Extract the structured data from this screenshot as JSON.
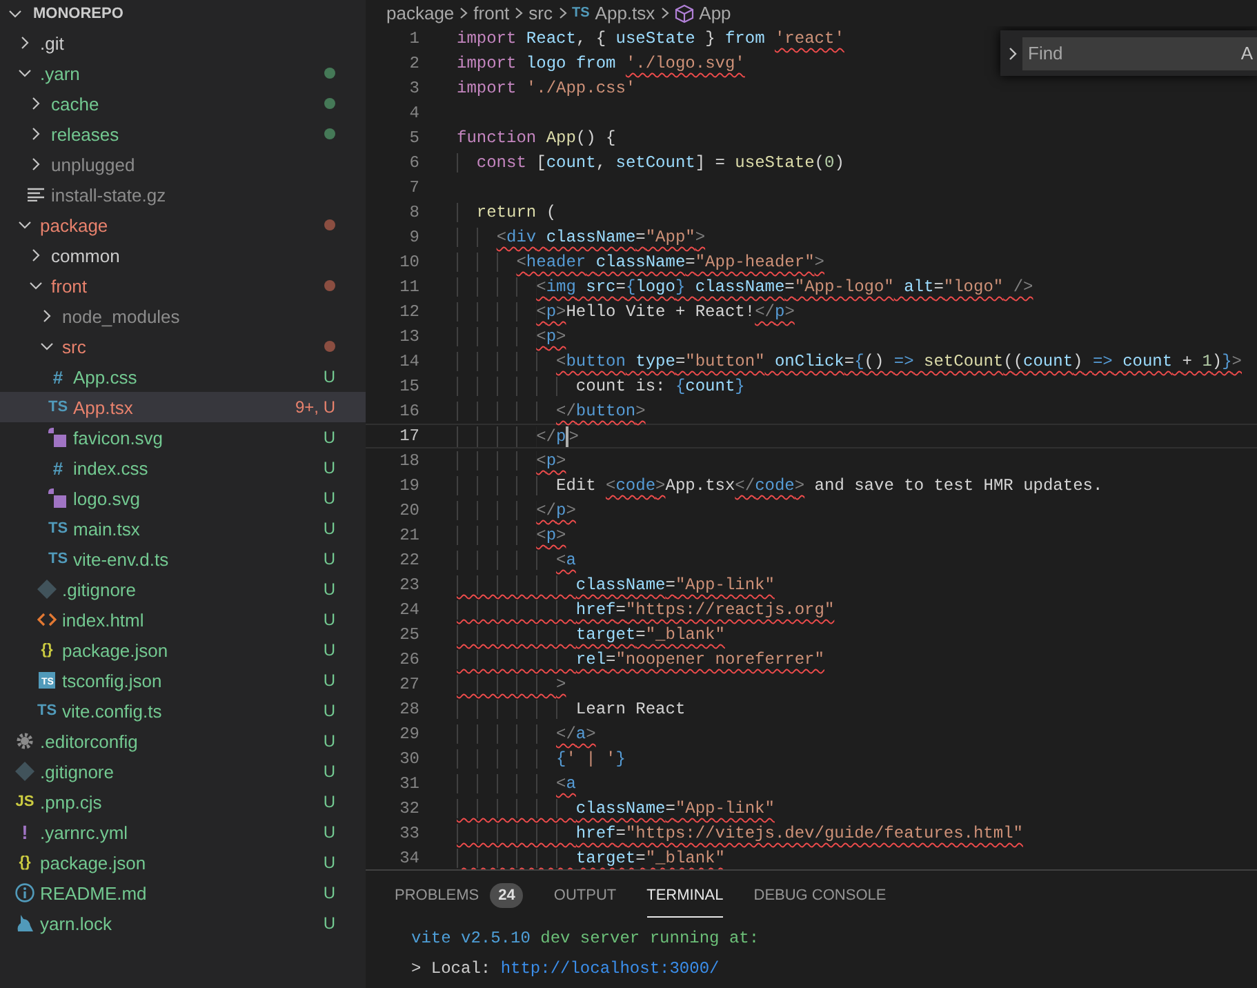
{
  "sidebar": {
    "title": "MONOREPO",
    "expanded": true,
    "items": [
      {
        "name": ".git",
        "kind": "folder",
        "expanded": false,
        "color": "#cccccc",
        "dot": false,
        "selected": false
      },
      {
        "name": ".yarn",
        "kind": "folder",
        "expanded": true,
        "color": "#73c991",
        "dot": true,
        "selected": false,
        "children": [
          {
            "name": "cache",
            "kind": "folder",
            "expanded": false,
            "color": "#73c991",
            "dot": true,
            "selected": false
          },
          {
            "name": "releases",
            "kind": "folder",
            "expanded": false,
            "color": "#73c991",
            "dot": true,
            "selected": false
          },
          {
            "name": "unplugged",
            "kind": "folder",
            "expanded": false,
            "color": "#8c8c8c",
            "dot": false,
            "selected": false
          },
          {
            "name": "install-state.gz",
            "kind": "lines",
            "color": "#8c8c8c",
            "selected": false
          }
        ]
      },
      {
        "name": "package",
        "kind": "folder",
        "expanded": true,
        "color": "#e8826d",
        "dot": true,
        "selected": false,
        "children": [
          {
            "name": "common",
            "kind": "folder",
            "expanded": false,
            "color": "#cccccc",
            "dot": false,
            "selected": false
          },
          {
            "name": "front",
            "kind": "folder",
            "expanded": true,
            "color": "#e8826d",
            "dot": true,
            "selected": false,
            "children": [
              {
                "name": "node_modules",
                "kind": "folder",
                "expanded": false,
                "color": "#8c8c8c",
                "dot": false,
                "selected": false
              },
              {
                "name": "src",
                "kind": "folder",
                "expanded": true,
                "color": "#e8826d",
                "dot": true,
                "selected": false,
                "children": [
                  {
                    "name": "App.css",
                    "kind": "css",
                    "glyph": "#",
                    "color": "#73c991",
                    "badge": "U",
                    "selected": false
                  },
                  {
                    "name": "App.tsx",
                    "kind": "ts",
                    "glyph": "TS",
                    "color": "#e8826d",
                    "badge": "9+, U",
                    "selected": true
                  },
                  {
                    "name": "favicon.svg",
                    "kind": "svg",
                    "color": "#73c991",
                    "badge": "U",
                    "selected": false
                  },
                  {
                    "name": "index.css",
                    "kind": "css",
                    "glyph": "#",
                    "color": "#73c991",
                    "badge": "U",
                    "selected": false
                  },
                  {
                    "name": "logo.svg",
                    "kind": "svg",
                    "color": "#73c991",
                    "badge": "U",
                    "selected": false
                  },
                  {
                    "name": "main.tsx",
                    "kind": "ts",
                    "glyph": "TS",
                    "color": "#73c991",
                    "badge": "U",
                    "selected": false
                  },
                  {
                    "name": "vite-env.d.ts",
                    "kind": "ts",
                    "glyph": "TS",
                    "color": "#73c991",
                    "badge": "U",
                    "selected": false
                  }
                ]
              },
              {
                "name": ".gitignore",
                "kind": "git",
                "color": "#73c991",
                "badge": "U",
                "selected": false
              },
              {
                "name": "index.html",
                "kind": "html",
                "color": "#73c991",
                "badge": "U",
                "selected": false
              },
              {
                "name": "package.json",
                "kind": "json",
                "glyph": "{}",
                "color": "#73c991",
                "badge": "U",
                "selected": false
              },
              {
                "name": "tsconfig.json",
                "kind": "tsconfig",
                "glyph": "TS",
                "color": "#73c991",
                "badge": "U",
                "selected": false
              },
              {
                "name": "vite.config.ts",
                "kind": "ts",
                "glyph": "TS",
                "color": "#73c991",
                "badge": "U",
                "selected": false
              }
            ]
          }
        ]
      },
      {
        "name": ".editorconfig",
        "kind": "gear",
        "color": "#73c991",
        "badge": "U",
        "selected": false
      },
      {
        "name": ".gitignore",
        "kind": "git",
        "color": "#73c991",
        "badge": "U",
        "selected": false
      },
      {
        "name": ".pnp.cjs",
        "kind": "js",
        "glyph": "JS",
        "color": "#73c991",
        "badge": "U",
        "selected": false
      },
      {
        "name": ".yarnrc.yml",
        "kind": "yaml",
        "glyph": "!",
        "color": "#73c991",
        "badge": "U",
        "selected": false
      },
      {
        "name": "package.json",
        "kind": "json",
        "glyph": "{}",
        "color": "#73c991",
        "badge": "U",
        "selected": false
      },
      {
        "name": "README.md",
        "kind": "info",
        "color": "#73c991",
        "badge": "U",
        "selected": false
      },
      {
        "name": "yarn.lock",
        "kind": "yarn",
        "color": "#73c991",
        "badge": "U",
        "selected": false
      }
    ]
  },
  "editor": {
    "breadcrumbs": [
      {
        "label": "package"
      },
      {
        "label": "front"
      },
      {
        "label": "src"
      },
      {
        "label": "App.tsx",
        "kind": "ts",
        "glyph": "TS"
      },
      {
        "label": "App",
        "kind": "cube"
      }
    ],
    "find": {
      "placeholder": "Find",
      "options": [
        "A"
      ]
    },
    "lines": [
      {
        "n": "1",
        "current": false,
        "kind": "string_error",
        "text": "import React, { useState } from 'react'"
      },
      {
        "n": "2",
        "current": false,
        "kind": "string_error",
        "text": "import logo from './logo.svg'"
      },
      {
        "n": "3",
        "current": false,
        "text": "import './App.css'"
      },
      {
        "n": "4",
        "current": false
      },
      {
        "n": "5",
        "current": false,
        "text": "function App() {"
      },
      {
        "n": "6",
        "current": false,
        "text": "  const [count, setCount] = useState(0)"
      },
      {
        "n": "7",
        "current": false
      },
      {
        "n": "8",
        "current": false,
        "text": "  return ("
      },
      {
        "n": "9",
        "current": false,
        "kind": "tag_error",
        "text": "    <div className=\"App\">"
      },
      {
        "n": "10",
        "current": false,
        "kind": "tag_error",
        "text": "      <header className=\"App-header\">"
      },
      {
        "n": "11",
        "current": false,
        "kind": "tag_error",
        "text": "        <img src={logo} className=\"App-logo\" alt=\"logo\" />"
      },
      {
        "n": "12",
        "current": false,
        "kind": "tag_error",
        "text": "        <p>Hello Vite + React!</p>"
      },
      {
        "n": "13",
        "current": false,
        "kind": "tag_error",
        "text": "        <p>"
      },
      {
        "n": "14",
        "current": false,
        "kind": "tag_error",
        "text": "          <button type=\"button\" onClick={() => setCount((count) => count + 1)}>"
      },
      {
        "n": "15",
        "current": false,
        "text": "            count is: {count}"
      },
      {
        "n": "16",
        "current": false,
        "kind": "tag_error",
        "text": "          </button>"
      },
      {
        "n": "17",
        "current": true,
        "text": "        </p>"
      },
      {
        "n": "18",
        "current": false,
        "kind": "tag_error",
        "text": "        <p>"
      },
      {
        "n": "19",
        "current": false,
        "kind": "tag_error",
        "text": "          Edit <code>App.tsx</code> and save to test HMR updates."
      },
      {
        "n": "20",
        "current": false,
        "kind": "tag_error",
        "text": "        </p>"
      },
      {
        "n": "21",
        "current": false,
        "kind": "tag_error",
        "text": "        <p>"
      },
      {
        "n": "22",
        "current": false,
        "kind": "tag_error",
        "text": "          <a"
      },
      {
        "n": "23",
        "current": false,
        "kind": "line_error",
        "text": "            className=\"App-link\""
      },
      {
        "n": "24",
        "current": false,
        "kind": "line_error",
        "text": "            href=\"https://reactjs.org\""
      },
      {
        "n": "25",
        "current": false,
        "kind": "line_error",
        "text": "            target=\"_blank\""
      },
      {
        "n": "26",
        "current": false,
        "kind": "line_error",
        "text": "            rel=\"noopener noreferrer\""
      },
      {
        "n": "27",
        "current": false,
        "kind": "line_error",
        "text": "          >"
      },
      {
        "n": "28",
        "current": false,
        "text": "            Learn React"
      },
      {
        "n": "29",
        "current": false,
        "kind": "tag_error",
        "text": "          </a>"
      },
      {
        "n": "30",
        "current": false,
        "text": "          {' | '}"
      },
      {
        "n": "31",
        "current": false,
        "kind": "tag_error",
        "text": "          <a"
      },
      {
        "n": "32",
        "current": false,
        "kind": "line_error",
        "text": "            className=\"App-link\""
      },
      {
        "n": "33",
        "current": false,
        "kind": "line_error",
        "text": "            href=\"https://vitejs.dev/guide/features.html\""
      },
      {
        "n": "34",
        "current": false,
        "kind": "line_error",
        "text": "            target=\"_blank\""
      }
    ]
  },
  "panel": {
    "tabs": [
      {
        "label": "PROBLEMS",
        "count": "24",
        "selected": false
      },
      {
        "label": "OUTPUT",
        "selected": false
      },
      {
        "label": "TERMINAL",
        "selected": true
      },
      {
        "label": "DEBUG CONSOLE",
        "selected": false
      }
    ],
    "terminal": [
      [
        {
          "kind": "blue",
          "t": "vite v2.5.10"
        },
        {
          "kind": "green",
          "t": " dev server running at:"
        }
      ],
      [
        {
          "kind": "plain",
          "t": "> Local: "
        },
        {
          "kind": "link",
          "t": "http://localhost:3000/"
        }
      ]
    ]
  }
}
